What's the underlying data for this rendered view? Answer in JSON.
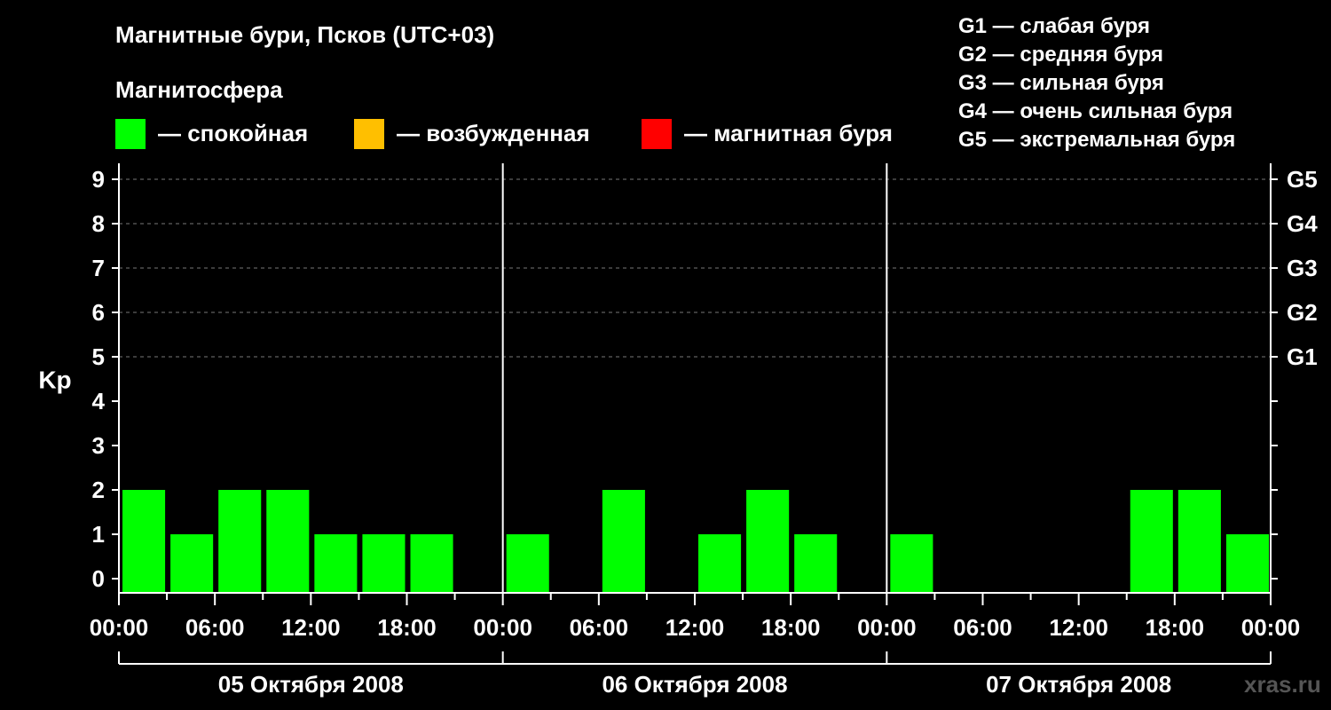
{
  "title": "Магнитные бури, Псков (UTC+03)",
  "legend": {
    "title": "Магнитосфера",
    "items": [
      {
        "label": "— спокойная",
        "color": "#00ff00"
      },
      {
        "label": "— возбужденная",
        "color": "#ffbf00"
      },
      {
        "label": "— магнитная буря",
        "color": "#ff0000"
      }
    ]
  },
  "g_legend": [
    "G1 — слабая буря",
    "G2 — средняя буря",
    "G3 — сильная буря",
    "G4 — очень сильная буря",
    "G5 — экстремальная буря"
  ],
  "watermark": "xras.ru",
  "chart_data": {
    "type": "bar",
    "ylabel": "Kp",
    "ylim": [
      0,
      9
    ],
    "yticks": [
      "0",
      "1",
      "2",
      "3",
      "4",
      "5",
      "6",
      "7",
      "8",
      "9"
    ],
    "right_ticks": [
      {
        "kp": 5,
        "label": "G1"
      },
      {
        "kp": 6,
        "label": "G2"
      },
      {
        "kp": 7,
        "label": "G3"
      },
      {
        "kp": 8,
        "label": "G4"
      },
      {
        "kp": 9,
        "label": "G5"
      }
    ],
    "xtick_labels": [
      "00:00",
      "06:00",
      "12:00",
      "18:00",
      "00:00",
      "06:00",
      "12:00",
      "18:00",
      "00:00",
      "06:00",
      "12:00",
      "18:00",
      "00:00"
    ],
    "days": [
      {
        "label": "05 Октября 2008",
        "values": [
          2,
          1,
          2,
          2,
          1,
          1,
          1,
          0
        ]
      },
      {
        "label": "06 Октября 2008",
        "values": [
          1,
          0,
          2,
          0,
          1,
          2,
          1,
          0
        ]
      },
      {
        "label": "07 Октября 2008",
        "values": [
          1,
          0,
          0,
          0,
          0,
          2,
          2,
          1
        ]
      }
    ],
    "interval_hours": 3,
    "bar_color": "#00ff00",
    "grid": true
  }
}
